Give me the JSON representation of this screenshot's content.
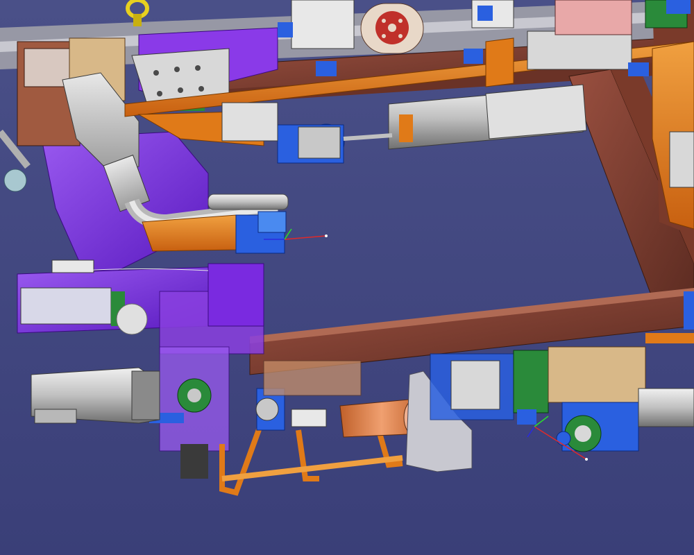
{
  "viewport": {
    "type": "3D CAD assembly view",
    "background_top": "#4a5088",
    "background_bottom": "#3a3f78"
  },
  "colors": {
    "frame_brown": "#8a4a3a",
    "frame_brown_dark": "#5a2a20",
    "orange": "#e07a18",
    "orange_light": "#f0a040",
    "purple": "#7a2ae0",
    "purple_light": "#9a5af0",
    "violet_transparent": "#8a40e0",
    "blue": "#2a60e0",
    "blue_light": "#4a8af0",
    "gray": "#c8c8c8",
    "gray_dark": "#8a8a8a",
    "white": "#e8e8e8",
    "green": "#2a8a3a",
    "copper": "#e08a5a",
    "tan": "#d8b888",
    "pink_plate": "#e8a8a8",
    "yellow": "#e8d020",
    "maroon": "#8a1a3a"
  },
  "icons": {
    "lifting_eye": "lifting-eye-icon",
    "axis_triad_upper": "axis-triad-icon",
    "axis_triad_lower": "axis-triad-icon"
  }
}
